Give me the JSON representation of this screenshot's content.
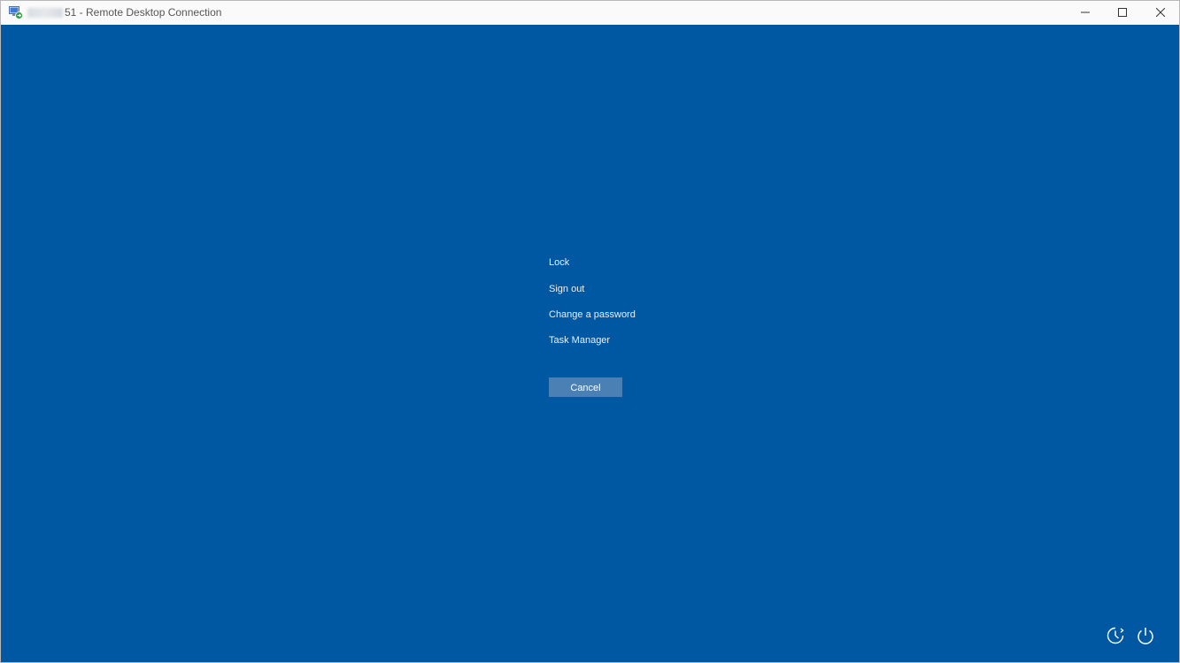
{
  "window": {
    "title_suffix": "51 - Remote Desktop Connection",
    "app_icon": "remote-desktop-icon",
    "controls": {
      "minimize_icon": "minimize-icon",
      "maximize_icon": "maximize-icon",
      "close_icon": "close-icon"
    }
  },
  "security_screen": {
    "background_color": "#0058a2",
    "menu": [
      {
        "label": "Lock"
      },
      {
        "label": "Sign out"
      },
      {
        "label": "Change a password"
      },
      {
        "label": "Task Manager"
      }
    ],
    "cancel_label": "Cancel",
    "corner_icons": [
      "accessibility-icon",
      "power-icon"
    ]
  }
}
